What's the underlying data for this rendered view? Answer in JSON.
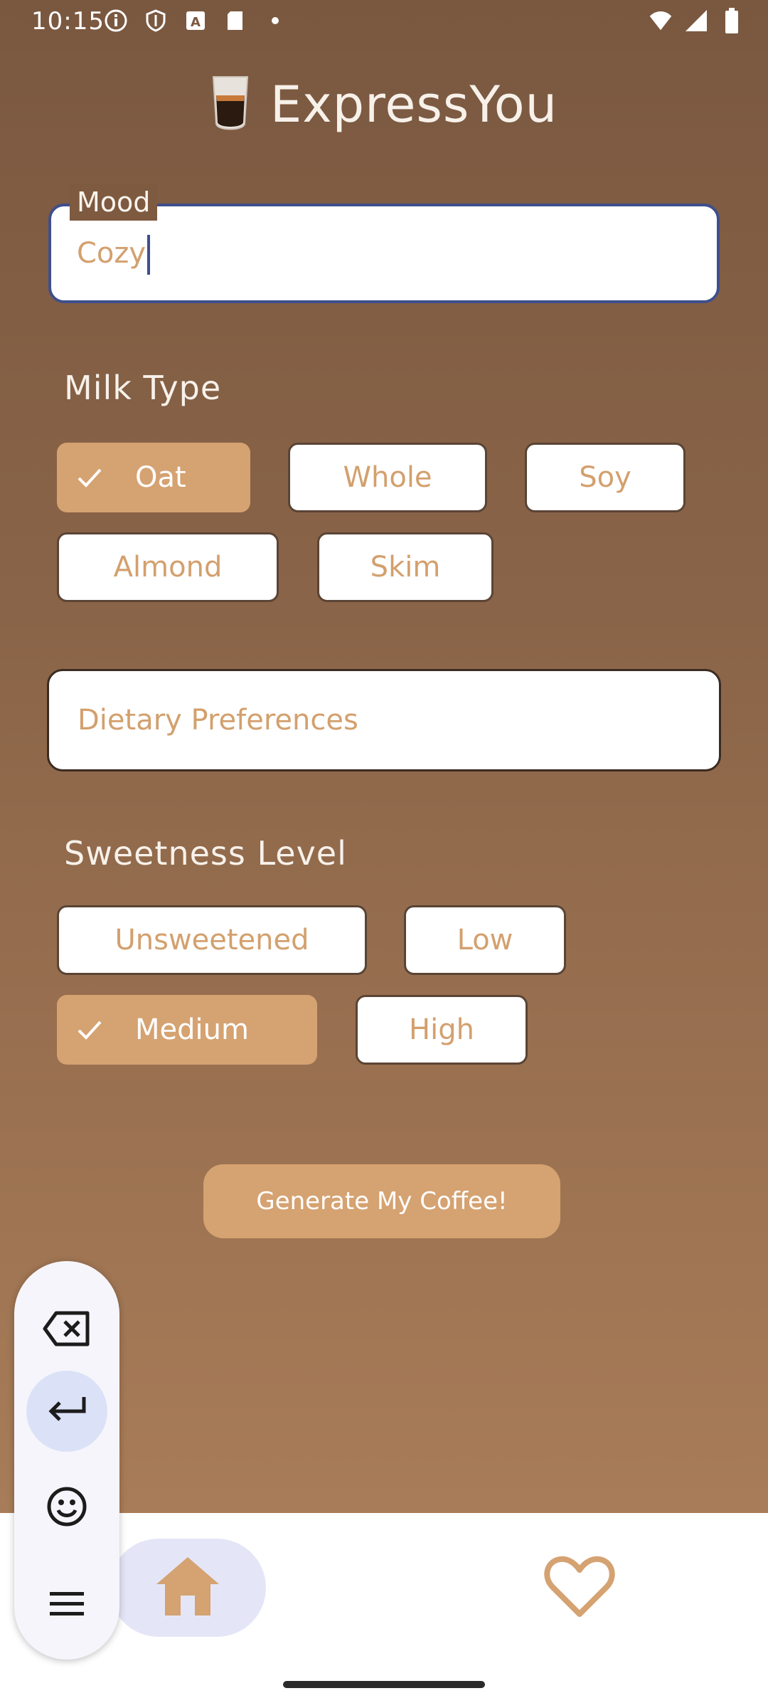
{
  "status_bar": {
    "time": "10:15",
    "icons_left": [
      "info-icon",
      "shield-icon",
      "a-box-icon",
      "sd-card-icon",
      "dot-icon"
    ],
    "icons_right": [
      "wifi-icon",
      "signal-icon",
      "battery-icon"
    ]
  },
  "header": {
    "title": "ExpressYou",
    "logo": "coffee-cup-icon"
  },
  "mood": {
    "label": "Mood",
    "value": "Cozy"
  },
  "milk": {
    "title": "Milk Type",
    "options": [
      {
        "label": "Oat",
        "selected": true
      },
      {
        "label": "Whole",
        "selected": false
      },
      {
        "label": "Soy",
        "selected": false
      },
      {
        "label": "Almond",
        "selected": false
      },
      {
        "label": "Skim",
        "selected": false
      }
    ]
  },
  "dietary": {
    "placeholder": "Dietary Preferences"
  },
  "sweetness": {
    "title": "Sweetness Level",
    "options": [
      {
        "label": "Unsweetened",
        "selected": false
      },
      {
        "label": "Low",
        "selected": false
      },
      {
        "label": "Medium",
        "selected": true
      },
      {
        "label": "High",
        "selected": false
      }
    ]
  },
  "generate": {
    "label": "Generate My Coffee!"
  },
  "keyboard_toolbar": {
    "icons": [
      "backspace-icon",
      "enter-icon",
      "emoji-icon",
      "menu-icon"
    ]
  },
  "bottom_nav": {
    "items": [
      "home-icon",
      "heart-icon"
    ]
  },
  "colors": {
    "accent": "#d5a271",
    "background_top": "#7a5840",
    "background_bottom": "#a87c58",
    "focus": "#3f4f8c"
  }
}
